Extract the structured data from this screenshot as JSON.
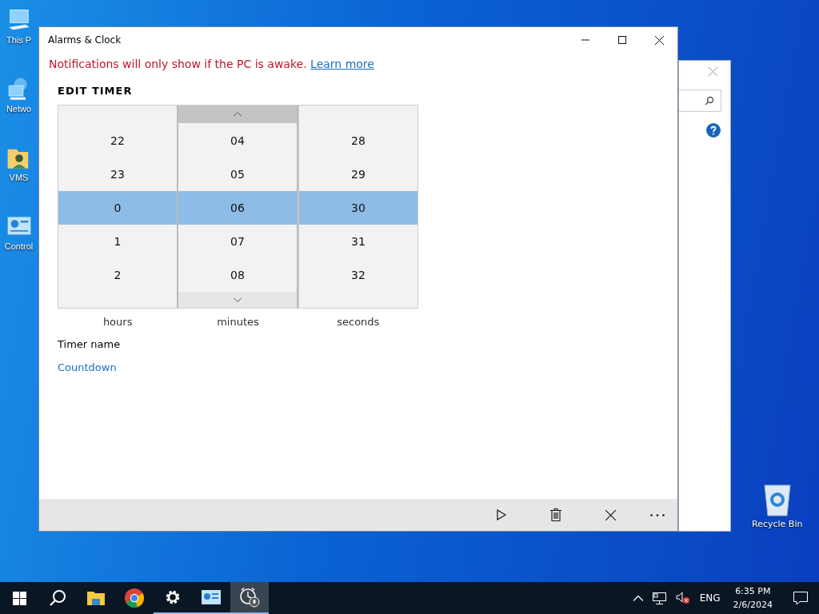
{
  "desktop_icons": [
    {
      "kind": "computer",
      "label": "This P"
    },
    {
      "kind": "network",
      "label": "Netwo"
    },
    {
      "kind": "folder",
      "label": "VMS"
    },
    {
      "kind": "control",
      "label": "Control"
    }
  ],
  "recycle_bin": {
    "label": "Recycle Bin"
  },
  "window": {
    "title": "Alarms & Clock",
    "notice": {
      "text": "Notifications will only show if the PC is awake.",
      "link": "Learn more"
    },
    "heading": "EDIT TIMER",
    "picker": [
      {
        "label": "hours",
        "hovered": false,
        "items": [
          {
            "text": "22",
            "selected": false
          },
          {
            "text": "23",
            "selected": false
          },
          {
            "text": "0",
            "selected": true
          },
          {
            "text": "1",
            "selected": false
          },
          {
            "text": "2",
            "selected": false
          }
        ]
      },
      {
        "label": "minutes",
        "hovered": true,
        "items": [
          {
            "text": "04",
            "selected": false
          },
          {
            "text": "05",
            "selected": false
          },
          {
            "text": "06",
            "selected": true
          },
          {
            "text": "07",
            "selected": false
          },
          {
            "text": "08",
            "selected": false
          }
        ]
      },
      {
        "label": "seconds",
        "hovered": false,
        "items": [
          {
            "text": "28",
            "selected": false
          },
          {
            "text": "29",
            "selected": false
          },
          {
            "text": "30",
            "selected": true
          },
          {
            "text": "31",
            "selected": false
          },
          {
            "text": "32",
            "selected": false
          }
        ]
      }
    ],
    "name_label": "Timer name",
    "name_value": "Countdown",
    "commands": [
      {
        "kind": "play"
      },
      {
        "kind": "delete"
      },
      {
        "kind": "close"
      },
      {
        "kind": "more"
      }
    ]
  },
  "taskbar": {
    "apps": [
      {
        "kind": "search",
        "running": false,
        "selected": false
      },
      {
        "kind": "explorer",
        "running": false,
        "selected": false
      },
      {
        "kind": "chrome",
        "running": false,
        "selected": false
      },
      {
        "kind": "settings",
        "running": true,
        "selected": false
      },
      {
        "kind": "control",
        "running": true,
        "selected": false
      },
      {
        "kind": "alarm",
        "running": true,
        "selected": true
      }
    ],
    "language": "ENG",
    "time": "6:35 PM",
    "date": "2/6/2024"
  }
}
